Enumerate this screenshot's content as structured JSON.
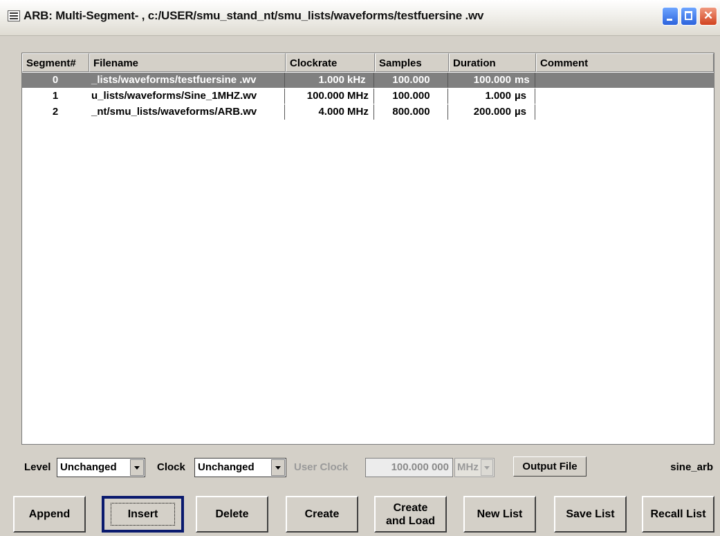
{
  "window": {
    "title": "ARB: Multi-Segment- , c:/USER/smu_stand_nt/smu_lists/waveforms/testfuersine .wv"
  },
  "table": {
    "columns": [
      "Segment#",
      "Filename",
      "Clockrate",
      "Samples",
      "Duration",
      "Comment"
    ],
    "rows": [
      {
        "segment": "0",
        "filename": "_lists/waveforms/testfuersine .wv",
        "clock_value": "1.000",
        "clock_unit": "kHz",
        "samples": "100.000",
        "duration_value": "100.000",
        "duration_unit": "ms",
        "comment": "",
        "selected": true
      },
      {
        "segment": "1",
        "filename": "u_lists/waveforms/Sine_1MHZ.wv",
        "clock_value": "100.000",
        "clock_unit": "MHz",
        "samples": "100.000",
        "duration_value": "1.000",
        "duration_unit": "µs",
        "comment": "",
        "selected": false
      },
      {
        "segment": "2",
        "filename": "_nt/smu_lists/waveforms/ARB.wv",
        "clock_value": "4.000",
        "clock_unit": "MHz",
        "samples": "800.000",
        "duration_value": "200.000",
        "duration_unit": "µs",
        "comment": "",
        "selected": false
      }
    ]
  },
  "controls": {
    "level_label": "Level",
    "level_value": "Unchanged",
    "clock_label": "Clock",
    "clock_value": "Unchanged",
    "user_clock_label": "User Clock",
    "user_clock_value": "100.000 000",
    "user_clock_unit": "MHz",
    "output_file_label": "Output File",
    "output_file_name": "sine_arb"
  },
  "buttons": {
    "append": "Append",
    "insert": "Insert",
    "delete": "Delete",
    "create": "Create",
    "create_and_load_1": "Create",
    "create_and_load_2": "and Load",
    "new_list": "New List",
    "save_list": "Save List",
    "recall_list": "Recall List"
  },
  "colors": {
    "selected_row": "#808080",
    "focus_border": "#0a1a6e"
  }
}
